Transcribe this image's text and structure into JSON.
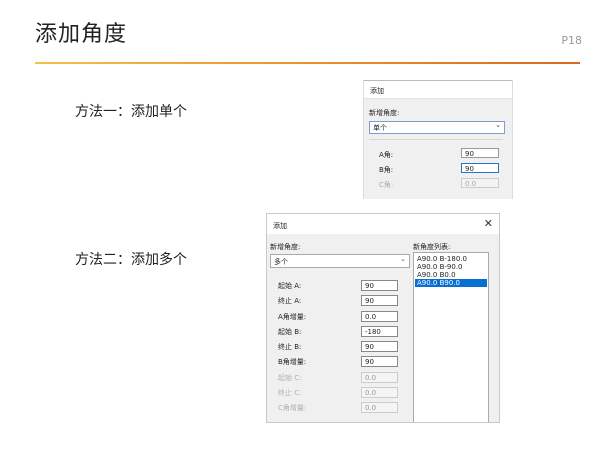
{
  "slide": {
    "title": "添加角度",
    "page_number": "P18",
    "accent_colors": [
      "#f2c24a",
      "#e9922b",
      "#d96a20"
    ]
  },
  "methods": {
    "single": "方法一：添加单个",
    "multiple": "方法二：添加多个"
  },
  "dialog_single": {
    "title": "添加",
    "new_angle_label": "新增角度:",
    "mode_value": "单个",
    "fields": [
      {
        "label": "A角:",
        "value": "90",
        "enabled": true
      },
      {
        "label": "B角:",
        "value": "90",
        "enabled": true
      },
      {
        "label": "C角:",
        "value": "0.0",
        "enabled": false
      }
    ]
  },
  "dialog_multiple": {
    "title": "添加",
    "new_angle_label": "新增角度:",
    "mode_value": "多个",
    "list_label": "新角度列表:",
    "params": [
      {
        "label": "起始 A:",
        "value": "90",
        "enabled": true
      },
      {
        "label": "终止 A:",
        "value": "90",
        "enabled": true
      },
      {
        "label": "A角增量:",
        "value": "0.0",
        "enabled": true
      },
      {
        "label": "起始 B:",
        "value": "-180",
        "enabled": true
      },
      {
        "label": "终止 B:",
        "value": "90",
        "enabled": true
      },
      {
        "label": "B角增量:",
        "value": "90",
        "enabled": true
      },
      {
        "label": "起始 C:",
        "value": "0.0",
        "enabled": false
      },
      {
        "label": "终止 C:",
        "value": "0.0",
        "enabled": false
      },
      {
        "label": "C角增量:",
        "value": "0.0",
        "enabled": false
      }
    ],
    "angle_list": [
      {
        "text": "A90.0 B-180.0",
        "selected": false
      },
      {
        "text": "A90.0 B-90.0",
        "selected": false
      },
      {
        "text": "A90.0 B0.0",
        "selected": false
      },
      {
        "text": "A90.0 B90.0",
        "selected": true
      }
    ]
  }
}
